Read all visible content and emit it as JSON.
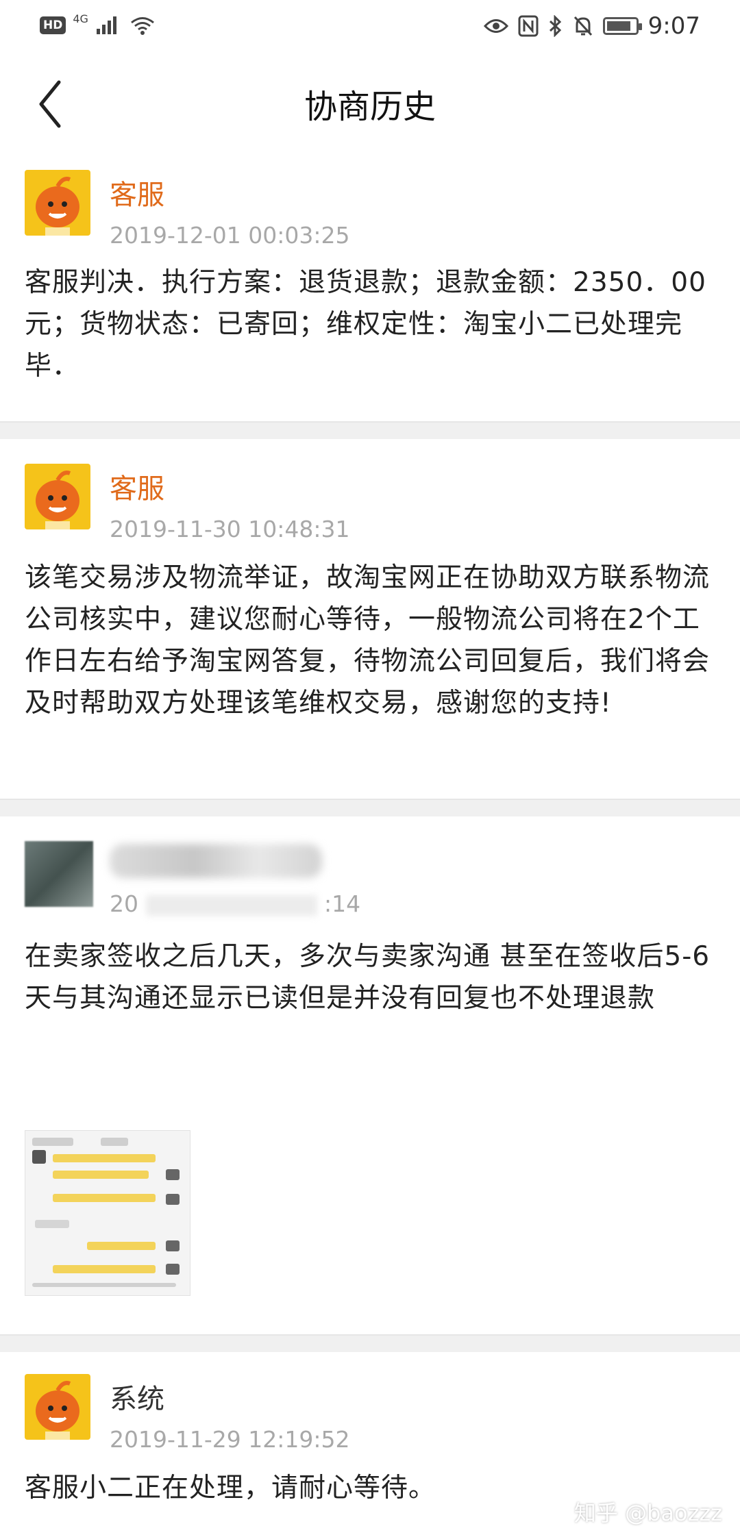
{
  "status_bar": {
    "hd_label": "HD",
    "network_label": "4G",
    "time": "9:07",
    "icons": [
      "signal-icon",
      "wifi-icon",
      "eye-icon",
      "nfc-icon",
      "bluetooth-icon",
      "mute-bell-icon",
      "battery-icon"
    ]
  },
  "header": {
    "title": "协商历史",
    "back_icon": "chevron-left-icon"
  },
  "records": [
    {
      "name": "客服",
      "time": "2019-12-01 00:03:25",
      "content": "客服判决．执行方案：退货退款；退款金额：2350．00元；货物状态：已寄回；维权定性：淘宝小二已处理完毕．"
    },
    {
      "name": "客服",
      "time": "2019-11-30 10:48:31",
      "content": "该笔交易涉及物流举证，故淘宝网正在协助双方联系物流公司核实中，建议您耐心等待，一般物流公司将在2个工作日左右给予淘宝网答复，待物流公司回复后，我们将会及时帮助双方处理该笔维权交易，感谢您的支持!"
    },
    {
      "name": "",
      "time_visible_start": "20",
      "time_visible_end": ":14",
      "content": "在卖家签收之后几天，多次与卖家沟通 甚至在签收后5-6天与其沟通还显示已读但是并没有回复也不处理退款"
    },
    {
      "name": "系统",
      "time": "2019-11-29 12:19:52",
      "content": "客服小二正在处理，请耐心等待。"
    }
  ],
  "watermark": "知乎 @baozzz",
  "colors": {
    "accent_name": "#e06a1a",
    "timestamp": "#a8a8a8",
    "divider": "#f0f0f0",
    "avatar_bg": "#f5c31a",
    "avatar_face": "#ea6a1d"
  },
  "battery_level": 0.85
}
